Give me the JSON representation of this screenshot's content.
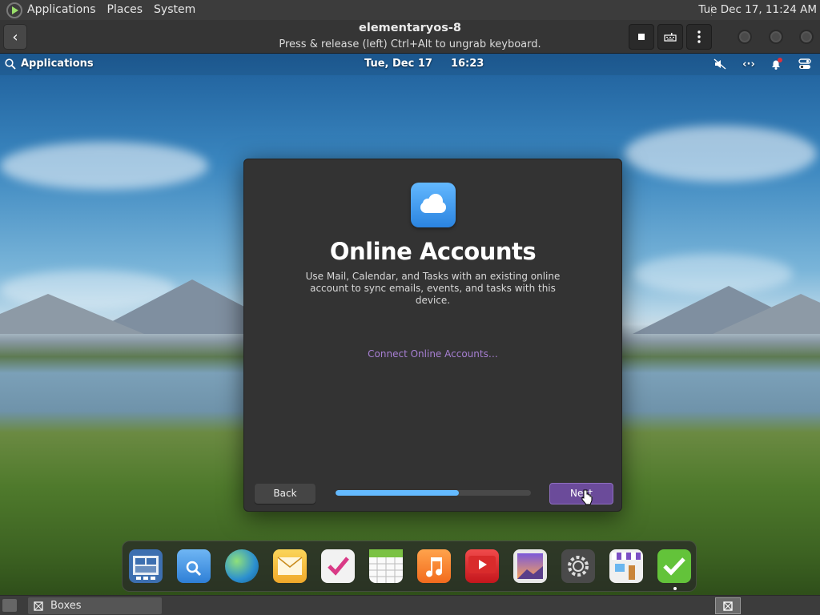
{
  "host_panel": {
    "menus": [
      "Applications",
      "Places",
      "System"
    ],
    "clock": "Tue Dec 17, 11:24 AM"
  },
  "boxes_header": {
    "title": "elementaryos-8",
    "subtitle": "Press & release (left) Ctrl+Alt to ungrab keyboard.",
    "icons": [
      "back-arrow-icon",
      "stop-icon",
      "keyboard-icon",
      "kebab-menu-icon",
      "minimize-icon",
      "maximize-icon",
      "close-icon"
    ]
  },
  "guest_panel": {
    "applications_label": "Applications",
    "date": "Tue, Dec 17",
    "time": "16:23",
    "indicators": [
      "muted-speaker-icon",
      "network-icon",
      "notifications-icon",
      "system-settings-icon"
    ]
  },
  "dialog": {
    "heading": "Online Accounts",
    "description": "Use Mail, Calendar, and Tasks with an existing online account to sync emails, events, and tasks with this device.",
    "connect_link": "Connect Online Accounts…",
    "back_label": "Back",
    "next_label": "Next",
    "progress": 0.63
  },
  "dock": {
    "apps": [
      "Multitasking View",
      "Files",
      "Web",
      "Mail",
      "Tasks",
      "Calendar",
      "Music",
      "Videos",
      "Photos",
      "System Settings",
      "AppCenter",
      "Onboarding"
    ]
  },
  "host_taskbar": {
    "task_label": "Boxes"
  },
  "colors": {
    "accent_purple": "#6b4b9a",
    "link_purple": "#a77fd3",
    "progress_blue": "#64baff",
    "dialog_bg": "#333333"
  }
}
